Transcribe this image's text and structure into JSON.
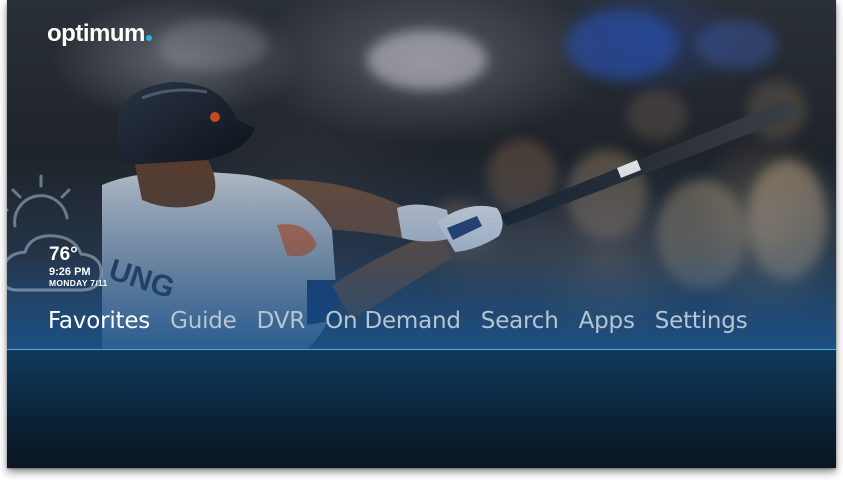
{
  "brand": {
    "logo_text": "optimum",
    "dot_color": "#1fb3e8"
  },
  "hero": {
    "jersey_lettering": "UNG"
  },
  "weather": {
    "icon": "partly-sunny-icon",
    "temperature": "76°",
    "time": "9:26 PM",
    "date": "MONDAY 7/11"
  },
  "nav": {
    "active_index": 0,
    "items": [
      {
        "label": "Favorites"
      },
      {
        "label": "Guide"
      },
      {
        "label": "DVR"
      },
      {
        "label": "On Demand"
      },
      {
        "label": "Search"
      },
      {
        "label": "Apps"
      },
      {
        "label": "Settings"
      }
    ]
  },
  "colors": {
    "active": "#ffffff",
    "inactive": "#b7c5d2",
    "divider": "#5aa6d6",
    "panel": "#0b2a44"
  }
}
